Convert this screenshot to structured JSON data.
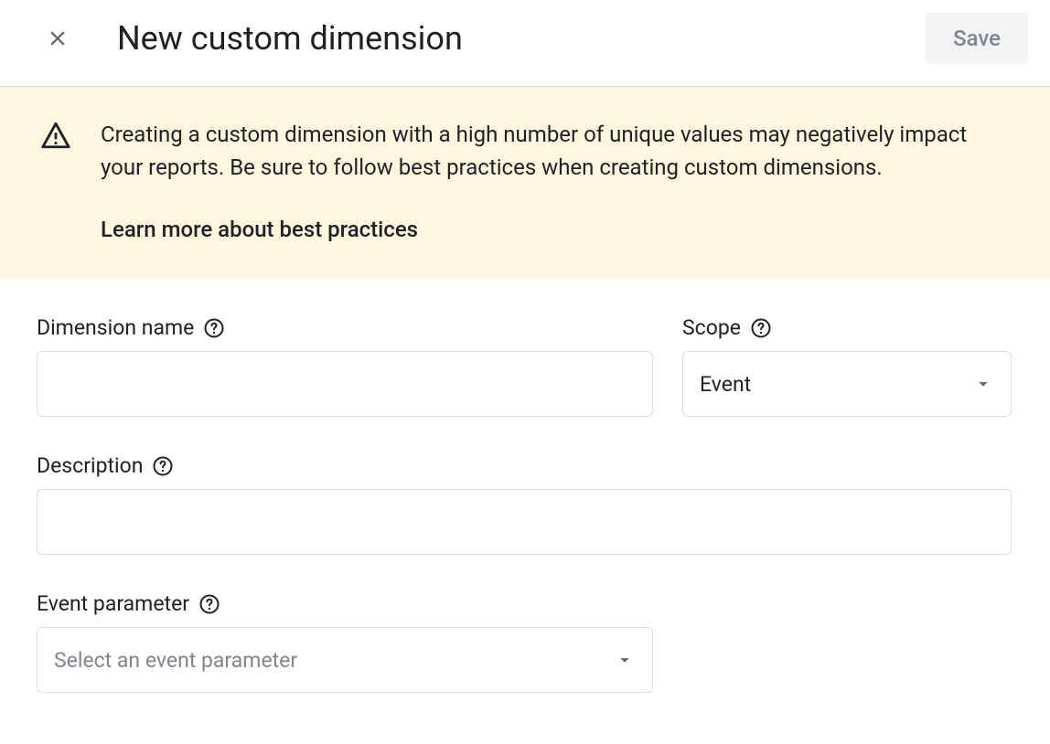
{
  "header": {
    "title": "New custom dimension",
    "save_label": "Save"
  },
  "banner": {
    "text": "Creating a custom dimension with a high number of unique values may negatively impact your reports. Be sure to follow best practices when creating custom dimensions.",
    "link_label": "Learn more about best practices"
  },
  "form": {
    "dimension_name": {
      "label": "Dimension name",
      "value": ""
    },
    "scope": {
      "label": "Scope",
      "selected": "Event"
    },
    "description": {
      "label": "Description",
      "value": ""
    },
    "event_parameter": {
      "label": "Event parameter",
      "placeholder": "Select an event parameter",
      "selected": ""
    }
  }
}
